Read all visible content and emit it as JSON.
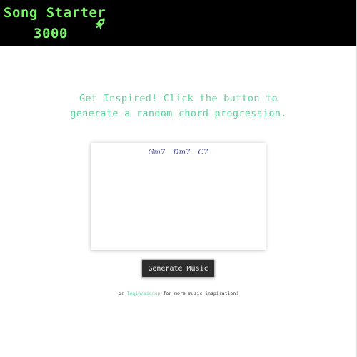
{
  "header": {
    "logo_line1": "Song Starter",
    "logo_line2": "3000",
    "logo_icon": "rocket-icon",
    "brand_color": "#7cf56a",
    "background_color": "#000000"
  },
  "main": {
    "tagline_line1": "Get Inspired! Click the button to",
    "tagline_line2": "generate a random chord progression.",
    "tagline_color": "#5fd19a",
    "chords": [
      "Gm7",
      "Dm7",
      "C7"
    ],
    "generate_button_label": "Generate Music",
    "footer_prefix": "or",
    "footer_link": "login/signup",
    "footer_suffix": "for more music inspiration!"
  }
}
